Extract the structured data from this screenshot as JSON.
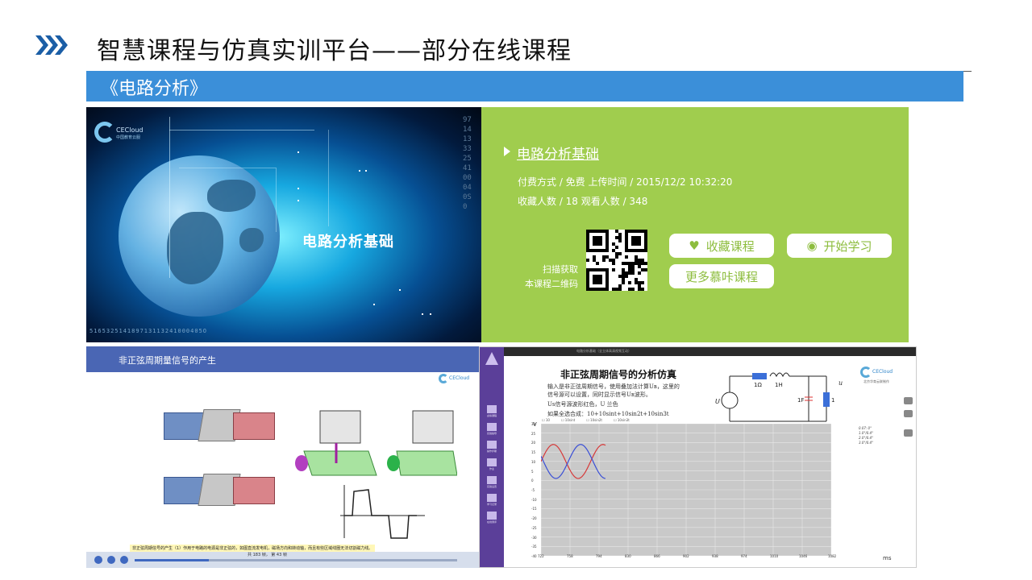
{
  "header": {
    "title": "智慧课程与仿真实训平台——部分在线课程",
    "course_name": "《电路分析》"
  },
  "hero": {
    "brand": "CECloud",
    "brand_sub": "中国教育云服",
    "title": "电路分析基础",
    "bottom_digits": "516532514189713113241000405O",
    "side_digits": "97141333254100040S0"
  },
  "info": {
    "course_title": "电路分析基础",
    "meta_line1": "付费方式 / 免费 上传时间 / 2015/12/2 10:32:20",
    "meta_line2": "收藏人数 / 18 观看人数 / 348",
    "qr_caption_1": "扫描获取",
    "qr_caption_2": "本课程二维码",
    "btn_favorite": "收藏课程",
    "btn_start": "开始学习",
    "btn_more": "更多慕咔课程",
    "accent": "#a0cd4e"
  },
  "lesson1": {
    "bar_title": "非正弦周期量信号的产生",
    "logo": "CECloud",
    "caption": "非正弦周期信号的产生（1）作用于电路的电源是非正弦的，如图直流发电机，磁场方向和转动轴，而且有些区域线圈无法切割磁力线。",
    "page_text": "共  183  帧，  第  43  帧",
    "progress": 0.23
  },
  "lesson2": {
    "topbar": "电路分析基础（全立体高清视频互动）",
    "title": "非正弦周期信号的分析仿真",
    "desc_1": "输入是非正弦周期信号，使用叠加法计算Uʙ，这里的",
    "desc_2": "信号源可以设置，同时显示信号Uʙ波形。",
    "desc_3": "Us信号源波形红色，U 兰色",
    "desc_4": "如果全选合成：10+10sint+10sin2t+10sin3t",
    "logo": "CECloud",
    "logo_sub": "北京华育云联制作",
    "notes": [
      "0.07:  0°",
      "1.0°/0.4°",
      "2.0°/0.4°",
      "3.0°/0.4°"
    ],
    "unit_x": "ms",
    "unit_y": "V",
    "checkboxes": [
      "10",
      "10sint",
      "10sin2t",
      "10sin3t"
    ],
    "sidebar": [
      "虚拟课程",
      "实验指导",
      "操作步骤",
      "作业",
      "实验设置",
      "学习记录",
      "在线测评"
    ],
    "circuit": {
      "r1": "1Ω",
      "l1": "1H",
      "c1": "1F",
      "r2": "1Ω",
      "us": "U",
      "ur": "u"
    },
    "xticks": [
      "722",
      "758",
      "794",
      "830",
      "866",
      "902",
      "938",
      "974",
      "1010",
      "1046",
      "1082"
    ],
    "yticks": [
      "30",
      "25",
      "20",
      "15",
      "10",
      "5",
      "0",
      "-5",
      "-10",
      "-15",
      "-20",
      "-25",
      "-30",
      "-35",
      "-40"
    ]
  }
}
